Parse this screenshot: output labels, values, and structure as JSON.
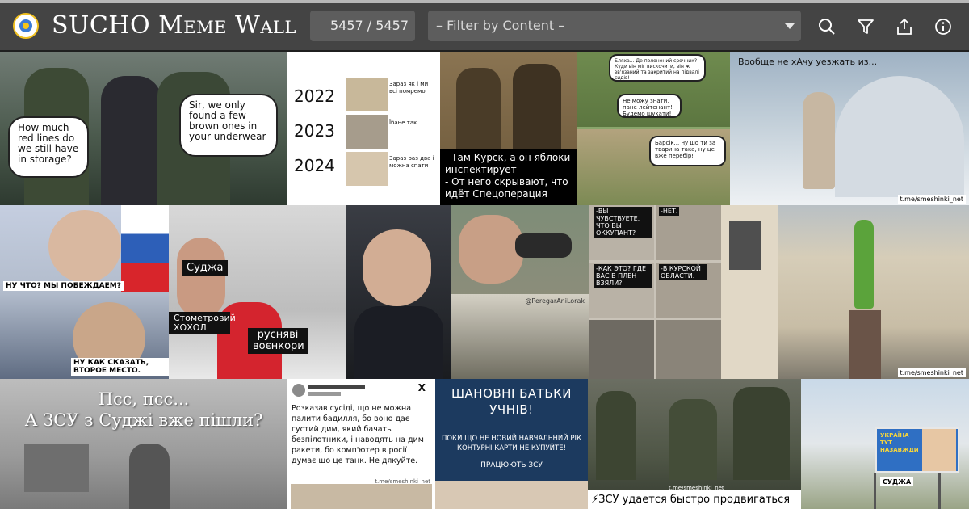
{
  "header": {
    "title": "SUCHO Meme Wall",
    "counter": "5457 / 5457",
    "filter_label": "– Filter by Content –"
  },
  "icons": [
    "search-icon",
    "filter-icon",
    "share-icon",
    "info-icon"
  ],
  "colors": {
    "header_bg": "#444444",
    "field_bg": "#5d5d5d",
    "page_bg": "#1f1f1f",
    "text": "#ffffff"
  },
  "memes": {
    "m1": {
      "left": "How much red lines do we still have in storage?",
      "right": "Sir, we only found a few brown ones in your underwear"
    },
    "m2": {
      "y1": "2022",
      "y2": "2023",
      "y3": "2024",
      "t1": "Зараз як і ми всі помремо",
      "t2": "Їбане так",
      "t3": "Зараз раз два і можна спати"
    },
    "m3": {
      "caption": "- Там Курск, а он яблоки инспектирует\n- От него скрывают, что идёт Спецоперация"
    },
    "m4": {
      "b1": "Бляха... Де полонений срочник? Куди він міг вискочити, він ж зв'язаний та закритий на підвалі сидів!",
      "b2": "Не можу знати, пане лейтенант! Будемо шукати!",
      "b3": "Барсік... ну шо ти за тварина така, ну це вже перебір!"
    },
    "m5": {
      "caption": "Вообще не хАчу уезжать из...",
      "watermark": "t.me/smeshinki_net"
    },
    "m6": {
      "top": "НУ ЧТО? МЫ ПОБЕЖДАЕМ?",
      "bottom": "НУ КАК СКАЗАТЬ, ВТОРОЕ МЕСТО."
    },
    "m7": {
      "l1": "Суджа",
      "l2": "Стометровий ХОХОЛ",
      "l3": "русняві воєнкори"
    },
    "m9": {
      "watermark": "@PeregarAniLorak"
    },
    "m10": {
      "q1": "-ВЫ ЧУВСТВУЕТЕ, ЧТО ВЫ ОККУПАНТ?",
      "a1": "-НЕТ.",
      "q2": "-КАК ЭТО? ГДЕ ВАС В ПЛЕН ВЗЯЛИ?",
      "a2": "-В КУРСКОЙ ОБЛАСТИ."
    },
    "m11": {
      "watermark": "t.me/smeshinki_net"
    },
    "m12": {
      "title": "Псс, псс...\nА ЗСУ з Суджі вже пішли?"
    },
    "m13": {
      "text": "Розказав сусіді, що не можна палити бадилля, бо воно дає густий дим, який бачать безпілотники, і наводять на дим ракети, бо комп'ютер в росії думає що це танк. Не дякуйте.",
      "watermark": "t.me/smeshinki_net",
      "x": "X"
    },
    "m14": {
      "title": "ШАНОВНІ БАТЬКИ УЧНІВ!",
      "body": "ПОКИ ЩО НЕ НОВИЙ НАВЧАЛЬНИЙ РІК КОНТУРНІ КАРТИ НЕ КУПУЙТЕ!",
      "sign": "ПРАЦЮЮТЬ ЗСУ"
    },
    "m15": {
      "caption": "⚡ЗСУ удается быстро продвигаться",
      "watermark": "t.me/smeshinki_net"
    },
    "m16": {
      "sign": "УКРАЇНА ТУТ НАЗАВЖДИ",
      "place": "СУДЖА"
    }
  }
}
